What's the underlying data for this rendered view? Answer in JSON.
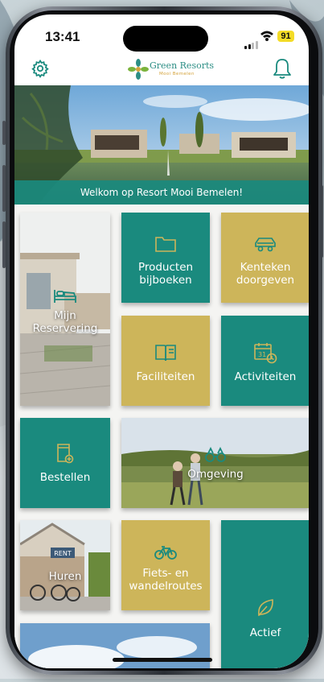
{
  "status_bar": {
    "time": "13:41",
    "battery": "91"
  },
  "header": {
    "logo_title": "Green Resorts",
    "logo_subtitle": "Mooi Bemelen",
    "icons": [
      "gear-icon",
      "bell-icon"
    ]
  },
  "hero": {
    "welcome": "Welkom op Resort Mooi Bemelen!"
  },
  "tiles": {
    "mijn_reservering": "Mijn\nReservering",
    "producten_bijboeken": "Producten\nbijboeken",
    "kenteken_doorgeven": "Kenteken\ndoorgeven",
    "faciliteiten": "Faciliteiten",
    "activiteiten": "Activiteiten",
    "bestellen": "Bestellen",
    "omgeving": "Omgeving",
    "huren": "Huren",
    "huren_sign": "RENT",
    "fiets_wandelroutes": "Fiets- en\nwandelroutes",
    "actief": "Actief",
    "calendar_day": "31"
  },
  "colors": {
    "teal": "#1a8a7e",
    "gold": "#cdb55a",
    "battery": "#f4dc27"
  }
}
